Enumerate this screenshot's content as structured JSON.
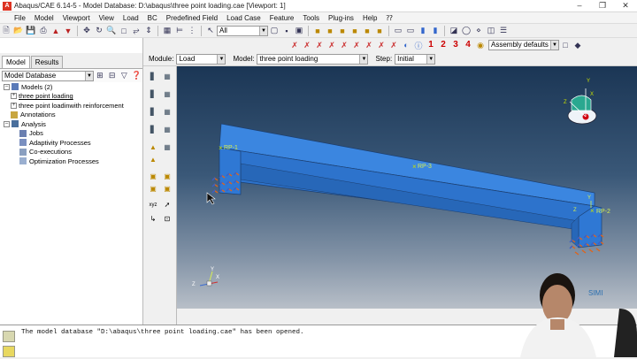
{
  "window": {
    "title": "Abaqus/CAE 6.14-5 - Model Database: D:\\abaqus\\three point loading.cae [Viewport: 1]",
    "app_icon": "A"
  },
  "menu": [
    {
      "label": "File"
    },
    {
      "label": "Model"
    },
    {
      "label": "Viewport"
    },
    {
      "label": "View"
    },
    {
      "label": "Load"
    },
    {
      "label": "BC"
    },
    {
      "label": "Predefined Field"
    },
    {
      "label": "Load Case"
    },
    {
      "label": "Feature"
    },
    {
      "label": "Tools"
    },
    {
      "label": "Plug-ins"
    },
    {
      "label": "Help"
    },
    {
      "label": "⁇"
    }
  ],
  "toolbar": {
    "selection_filter": "All",
    "assembly_defaults": "Assembly defaults",
    "step_numbers": [
      "1",
      "2",
      "3",
      "4"
    ]
  },
  "context": {
    "module_label": "Module:",
    "module_value": "Load",
    "model_label": "Model:",
    "model_value": "three point loading",
    "step_label": "Step:",
    "step_value": "Initial"
  },
  "tabs": {
    "model": "Model",
    "results": "Results"
  },
  "tree": {
    "database": "Model Database",
    "models": "Models (2)",
    "model1": "three point loading",
    "model2": "three point loadinwith reinforcement",
    "annotations": "Annotations",
    "analysis": "Analysis",
    "jobs": "Jobs",
    "adaptivity": "Adaptivity Processes",
    "coexec": "Co-executions",
    "optimization": "Optimization Processes"
  },
  "viewport": {
    "rp1": "RP-1",
    "rp2": "RP-2",
    "rp3": "RP-3",
    "triad_x": "X",
    "triad_y": "Y",
    "triad_z": "Z",
    "local_y": "Y",
    "local_z": "Z",
    "view_y": "Y",
    "view_x": "X",
    "view_z": "Z",
    "logo_text": "SIMI"
  },
  "message": "The model database \"D:\\abaqus\\three point loading.cae\" has been opened.",
  "colors": {
    "beam_top": "#3a86e0",
    "beam_side": "#2e74cc",
    "beam_dark": "#1f5aa8",
    "bc_marker": "#e0641a",
    "rp_marker": "#c8e000"
  }
}
